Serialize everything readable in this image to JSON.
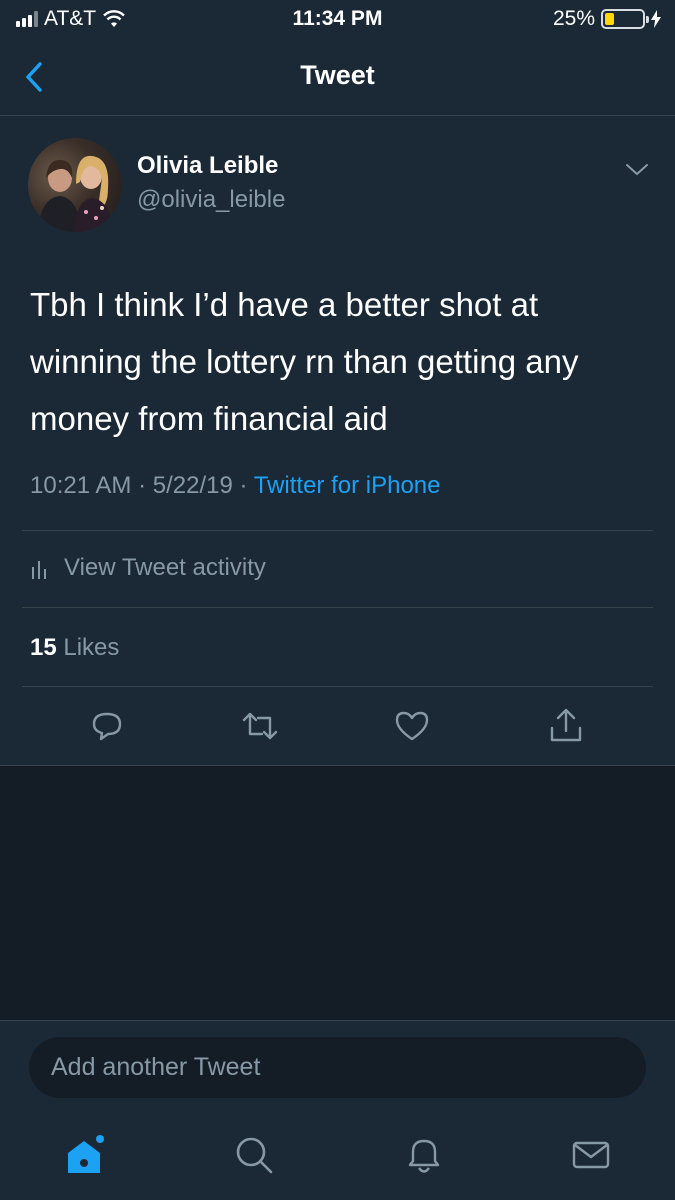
{
  "status_bar": {
    "carrier": "AT&T",
    "time": "11:34 PM",
    "battery_percent": "25%",
    "battery_level": 0.25,
    "signal_bars": 3,
    "signal_max": 4
  },
  "nav": {
    "title": "Tweet",
    "back_icon": "chevron-left-icon"
  },
  "tweet": {
    "author_name": "Olivia Leible",
    "author_handle": "@olivia_leible",
    "text": "Tbh I think I’d have a better shot at winning the lottery rn than getting any money from financial aid",
    "time": "10:21 AM",
    "date": "5/22/19",
    "separator": "·",
    "source": "Twitter for iPhone",
    "activity_label": "View Tweet activity",
    "likes_count": "15",
    "likes_label": "Likes",
    "actions": [
      "reply-icon",
      "retweet-icon",
      "like-icon",
      "share-icon"
    ]
  },
  "compose": {
    "placeholder": "Add another Tweet"
  },
  "tab_bar": [
    "home-icon",
    "search-icon",
    "notifications-icon",
    "messages-icon"
  ],
  "colors": {
    "background": "#141d26",
    "surface": "#1b2836",
    "accent": "#1da1f2",
    "secondary_text": "#8899a6",
    "divider": "#38444d",
    "battery": "#ffd60a"
  }
}
